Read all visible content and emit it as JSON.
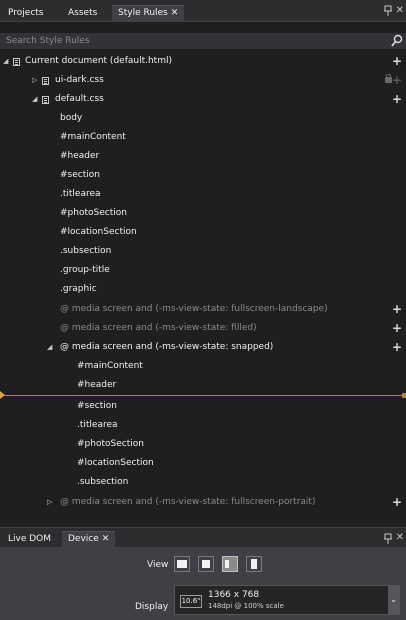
{
  "top_tabs": {
    "projects": "Projects",
    "assets": "Assets",
    "style_rules": "Style Rules",
    "close_glyph": "✕",
    "pin_glyph": "ᵖ",
    "window_close_glyph": "✕"
  },
  "search": {
    "placeholder": "Search Style Rules"
  },
  "tree": {
    "current_document": "Current document (default.html)",
    "ui_dark": "ui-dark.css",
    "default_css": "default.css",
    "rules": [
      "body",
      "#mainContent",
      "#header",
      "#section",
      ".titlearea",
      "#photoSection",
      "#locationSection",
      ".subsection",
      ".group-title",
      ".graphic"
    ],
    "media_landscape": "@ media screen and (-ms-view-state: fullscreen-landscape)",
    "media_filled": "@ media screen and (-ms-view-state: filled)",
    "media_snapped": "@ media screen and (-ms-view-state: snapped)",
    "snapped_rules": [
      "#mainContent",
      "#header",
      "#section",
      ".titlearea",
      "#photoSection",
      "#locationSection",
      ".subsection"
    ],
    "media_portrait": "@ media screen and (-ms-view-state: fullscreen-portrait)",
    "add_glyph": "+"
  },
  "bottom_tabs": {
    "live_dom": "Live DOM",
    "device": "Device"
  },
  "device": {
    "view_label": "View",
    "display_label": "Display",
    "screen_size": "10.6\"",
    "resolution": "1366 x 768",
    "dpi": "148dpi @ 100% scale",
    "dropdown_glyph": "⌄"
  },
  "colors": {
    "background": "#1f1f1f",
    "tab_bar": "#2d2d30",
    "insertion_line": "#b08a2e",
    "device_panel": "#3f3f46"
  }
}
